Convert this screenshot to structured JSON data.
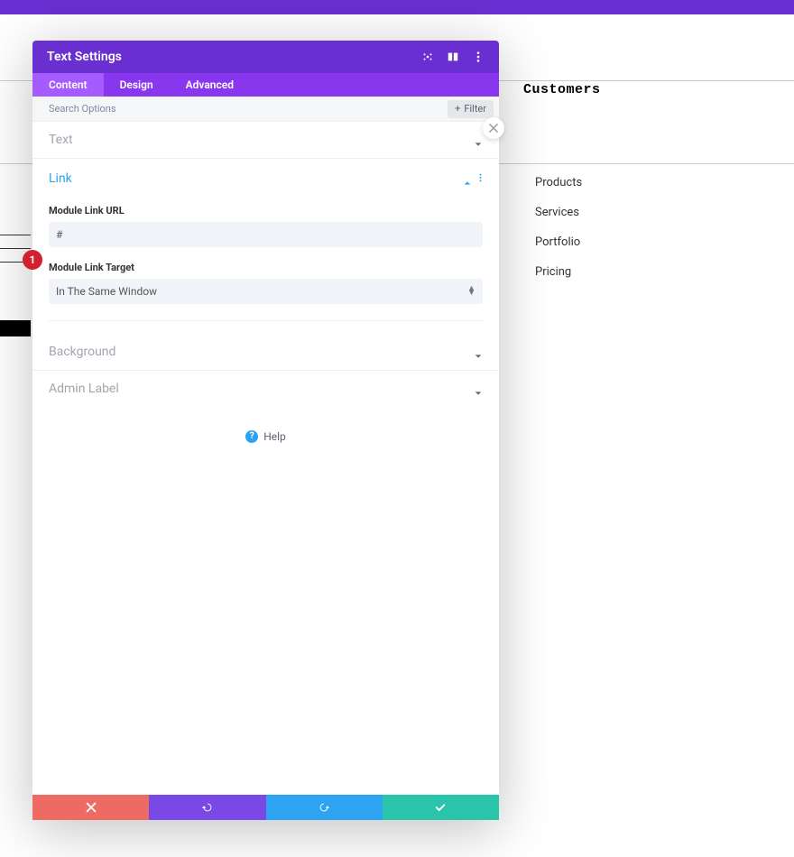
{
  "topHeading": "Customers",
  "sideList": [
    "Products",
    "Services",
    "Portfolio",
    "Pricing"
  ],
  "modal": {
    "title": "Text Settings",
    "tabs": {
      "content": "Content",
      "design": "Design",
      "advanced": "Advanced",
      "active": "content"
    },
    "search": {
      "placeholder": "Search Options",
      "filterLabel": "Filter"
    },
    "sections": {
      "text": "Text",
      "link": {
        "title": "Link",
        "url": {
          "label": "Module Link URL",
          "value": "#"
        },
        "target": {
          "label": "Module Link Target",
          "value": "In The Same Window"
        }
      },
      "background": "Background",
      "adminLabel": "Admin Label"
    },
    "help": "Help",
    "badge": "1"
  }
}
